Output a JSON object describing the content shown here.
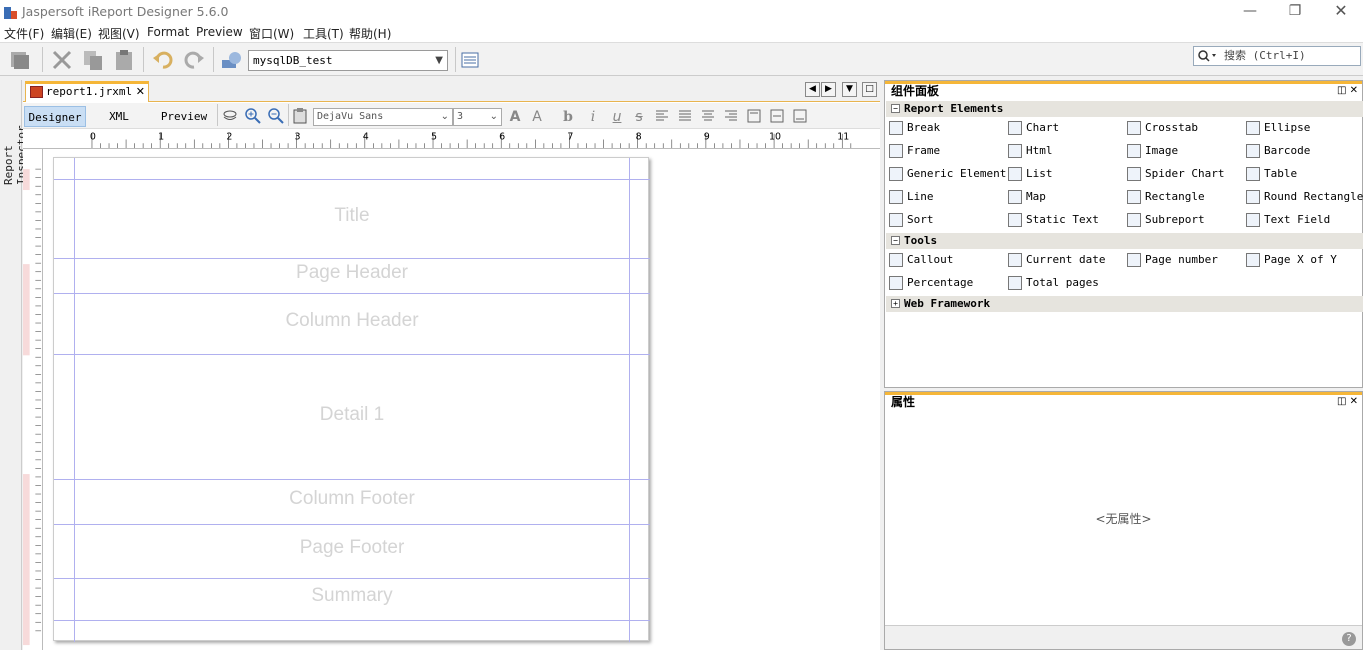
{
  "window": {
    "title": "Jaspersoft iReport Designer 5.6.0"
  },
  "menu": [
    "文件(F)",
    "编辑(E)",
    "视图(V)",
    "Format",
    "Preview",
    "窗口(W)",
    "工具(T)",
    "帮助(H)"
  ],
  "toolbar": {
    "datasource": "mysqlDB_test",
    "search_placeholder": "搜索 (Ctrl+I)"
  },
  "inspector_label": "Report Inspector",
  "editor": {
    "tab_label": "report1.jrxml",
    "modes": [
      "Designer",
      "XML",
      "Preview"
    ],
    "font": "DejaVu Sans",
    "font_size": "3",
    "format_buttons": [
      "b",
      "i",
      "u",
      "s"
    ],
    "ruler_numbers": [
      "0",
      "1",
      "2",
      "3",
      "4",
      "5",
      "6",
      "7",
      "8",
      "9",
      "10",
      "11"
    ],
    "bands": [
      "Title",
      "Page Header",
      "Column Header",
      "Detail 1",
      "Column Footer",
      "Page Footer",
      "Summary"
    ]
  },
  "palette": {
    "title": "组件面板",
    "sections": [
      {
        "name": "Report Elements",
        "expanded": "true",
        "items": [
          "Break",
          "Chart",
          "Crosstab",
          "Ellipse",
          "Frame",
          "Html",
          "Image",
          "Barcode",
          "Generic Element",
          "List",
          "Spider Chart",
          "Table",
          "Line",
          "Map",
          "Rectangle",
          "Round Rectangle",
          "Sort",
          "Static Text",
          "Subreport",
          "Text Field"
        ]
      },
      {
        "name": "Tools",
        "expanded": "true",
        "items": [
          "Callout",
          "Current date",
          "Page number",
          "Page X of Y",
          "Percentage",
          "Total pages"
        ]
      },
      {
        "name": "Web Framework",
        "expanded": "false",
        "items": []
      }
    ]
  },
  "properties": {
    "title": "属性",
    "empty_text": "<无属性>"
  }
}
